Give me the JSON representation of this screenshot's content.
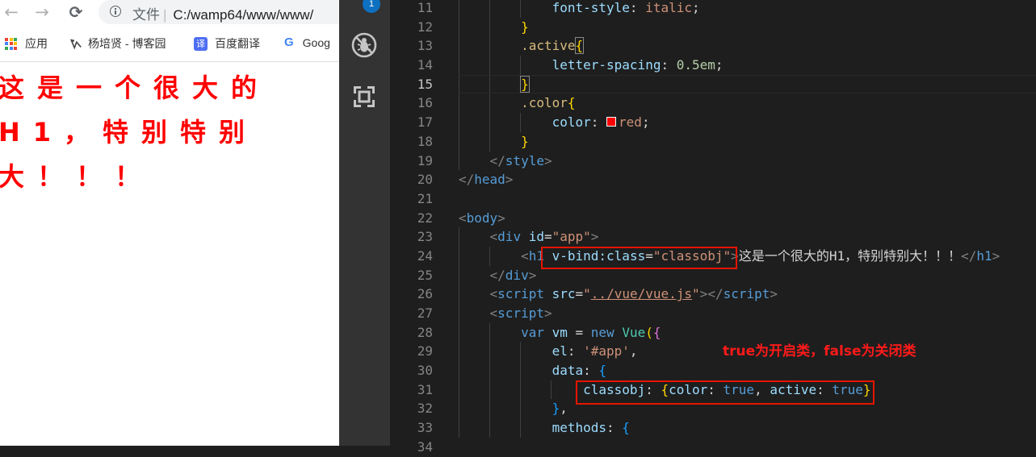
{
  "browser": {
    "nav": {
      "back": "←",
      "forward": "→",
      "reload": "⟳"
    },
    "omnibox": {
      "scheme_label": "文件",
      "separator": "|",
      "url": "C:/wamp64/www/www/"
    },
    "bookmarks": [
      {
        "label": "应用",
        "icon": "apps-grid-icon"
      },
      {
        "label": "杨培贤 - 博客园",
        "icon": "cnblogs-icon"
      },
      {
        "label": "百度翻译",
        "icon": "baidu-translate-icon",
        "icon_text": "译"
      },
      {
        "label": "Goog",
        "icon": "google-icon",
        "icon_text": "G"
      }
    ],
    "page_heading": "这是一个很大的H1，特别特别大！！！"
  },
  "activity_bar": {
    "badge": "1",
    "icons": [
      "no-debug-icon",
      "remote-explorer-icon"
    ]
  },
  "editor": {
    "current_line": 15,
    "lines": [
      {
        "n": "11",
        "tokens": [
          [
            "            ",
            ""
          ],
          [
            "font-style",
            "prop"
          ],
          [
            ": ",
            "punc"
          ],
          [
            "italic",
            "val"
          ],
          [
            ";",
            "punc"
          ]
        ]
      },
      {
        "n": "12",
        "tokens": [
          [
            "        ",
            ""
          ],
          [
            "}",
            "br1"
          ]
        ]
      },
      {
        "n": "13",
        "tokens": [
          [
            "        ",
            ""
          ],
          [
            ".active",
            "sel"
          ],
          [
            "{",
            "br1 box"
          ]
        ]
      },
      {
        "n": "14",
        "tokens": [
          [
            "            ",
            ""
          ],
          [
            "letter-spacing",
            "prop"
          ],
          [
            ": ",
            "punc"
          ],
          [
            "0.5em",
            "num"
          ],
          [
            ";",
            "punc"
          ]
        ]
      },
      {
        "n": "15",
        "tokens": [
          [
            "        ",
            ""
          ],
          [
            "}",
            "br1 box"
          ]
        ]
      },
      {
        "n": "16",
        "tokens": [
          [
            "        ",
            ""
          ],
          [
            ".color",
            "sel"
          ],
          [
            "{",
            "br1"
          ]
        ]
      },
      {
        "n": "17",
        "tokens": [
          [
            "            ",
            ""
          ],
          [
            "color",
            "prop"
          ],
          [
            ": ",
            "punc"
          ],
          [
            "",
            "swatch"
          ],
          [
            "red",
            "val"
          ],
          [
            ";",
            "punc"
          ]
        ]
      },
      {
        "n": "18",
        "tokens": [
          [
            "        ",
            ""
          ],
          [
            "}",
            "br1"
          ]
        ]
      },
      {
        "n": "19",
        "tokens": [
          [
            "    ",
            ""
          ],
          [
            "</",
            "ang"
          ],
          [
            "style",
            "tag"
          ],
          [
            ">",
            "ang"
          ]
        ]
      },
      {
        "n": "20",
        "tokens": [
          [
            "</",
            "ang"
          ],
          [
            "head",
            "tag"
          ],
          [
            ">",
            "ang"
          ]
        ]
      },
      {
        "n": "21",
        "tokens": []
      },
      {
        "n": "22",
        "tokens": [
          [
            "<",
            "ang"
          ],
          [
            "body",
            "tag"
          ],
          [
            ">",
            "ang"
          ]
        ]
      },
      {
        "n": "23",
        "tokens": [
          [
            "    ",
            ""
          ],
          [
            "<",
            "ang"
          ],
          [
            "div",
            "tag"
          ],
          [
            " ",
            ""
          ],
          [
            "id",
            "attr"
          ],
          [
            "=",
            "punc"
          ],
          [
            "\"app\"",
            "str"
          ],
          [
            ">",
            "ang"
          ]
        ]
      },
      {
        "n": "24",
        "tokens": [
          [
            "        ",
            ""
          ],
          [
            "<",
            "ang"
          ],
          [
            "h1",
            "tag"
          ],
          [
            " ",
            ""
          ],
          [
            "v-bind:class",
            "attr"
          ],
          [
            "=",
            "punc"
          ],
          [
            "\"classobj\"",
            "str"
          ],
          [
            ">",
            "ang"
          ],
          [
            "这是一个很大的H1，特别特别大！！！",
            "text"
          ],
          [
            "</",
            "ang"
          ],
          [
            "h1",
            "tag"
          ],
          [
            ">",
            "ang"
          ]
        ]
      },
      {
        "n": "25",
        "tokens": [
          [
            "    ",
            ""
          ],
          [
            "</",
            "ang"
          ],
          [
            "div",
            "tag"
          ],
          [
            ">",
            "ang"
          ]
        ]
      },
      {
        "n": "26",
        "tokens": [
          [
            "    ",
            ""
          ],
          [
            "<",
            "ang"
          ],
          [
            "script",
            "tag"
          ],
          [
            " ",
            ""
          ],
          [
            "src",
            "attr"
          ],
          [
            "=",
            "punc"
          ],
          [
            "\"",
            "str"
          ],
          [
            "../vue/vue.js",
            "str u"
          ],
          [
            "\"",
            "str"
          ],
          [
            ">",
            "ang"
          ],
          [
            "</",
            "ang"
          ],
          [
            "script",
            "tag"
          ],
          [
            ">",
            "ang"
          ]
        ]
      },
      {
        "n": "27",
        "tokens": [
          [
            "    ",
            ""
          ],
          [
            "<",
            "ang"
          ],
          [
            "script",
            "tag"
          ],
          [
            ">",
            "ang"
          ]
        ]
      },
      {
        "n": "28",
        "tokens": [
          [
            "        ",
            ""
          ],
          [
            "var",
            "kw"
          ],
          [
            " ",
            ""
          ],
          [
            "vm",
            "var"
          ],
          [
            " = ",
            "punc"
          ],
          [
            "new",
            "kw"
          ],
          [
            " ",
            ""
          ],
          [
            "Vue",
            "cls"
          ],
          [
            "(",
            "br1"
          ],
          [
            "{",
            "br2"
          ]
        ]
      },
      {
        "n": "29",
        "tokens": [
          [
            "            ",
            ""
          ],
          [
            "el",
            "var"
          ],
          [
            ": ",
            "punc"
          ],
          [
            "'#app'",
            "str"
          ],
          [
            ",",
            "punc"
          ]
        ]
      },
      {
        "n": "30",
        "tokens": [
          [
            "            ",
            ""
          ],
          [
            "data",
            "var"
          ],
          [
            ": ",
            "punc"
          ],
          [
            "{",
            "br3"
          ]
        ]
      },
      {
        "n": "31",
        "tokens": [
          [
            "                ",
            ""
          ],
          [
            "classobj",
            "var"
          ],
          [
            ": ",
            "punc"
          ],
          [
            "{",
            "br1"
          ],
          [
            "color",
            "var"
          ],
          [
            ": ",
            "punc"
          ],
          [
            "true",
            "bool"
          ],
          [
            ", ",
            "punc"
          ],
          [
            "active",
            "var"
          ],
          [
            ": ",
            "punc"
          ],
          [
            "true",
            "bool"
          ],
          [
            "}",
            "br1"
          ]
        ]
      },
      {
        "n": "32",
        "tokens": [
          [
            "            ",
            ""
          ],
          [
            "}",
            "br3"
          ],
          [
            ",",
            "punc"
          ]
        ]
      },
      {
        "n": "33",
        "tokens": [
          [
            "            ",
            ""
          ],
          [
            "methods",
            "var"
          ],
          [
            ": ",
            "punc"
          ],
          [
            "{",
            "br3"
          ]
        ]
      },
      {
        "n": "34",
        "tokens": []
      }
    ]
  },
  "annotation": {
    "note": "true为开启类，false为关闭类",
    "highlight_color": "#e51400"
  }
}
